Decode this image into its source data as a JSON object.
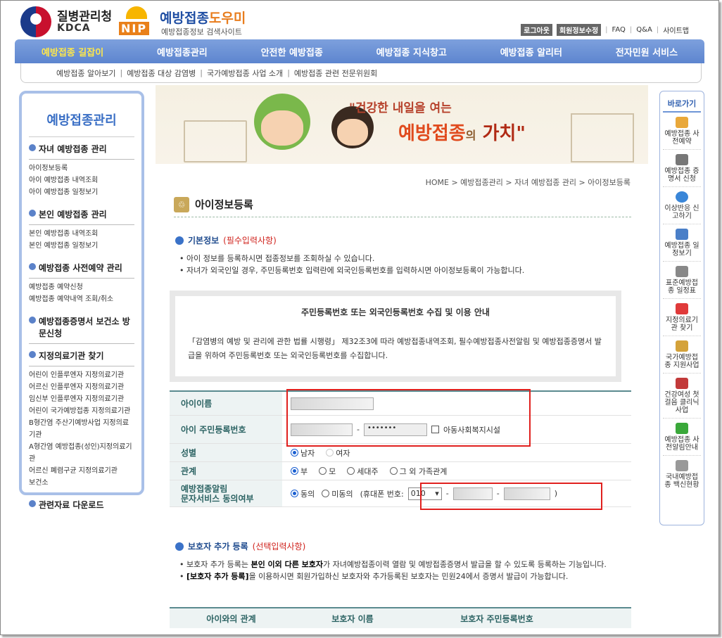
{
  "header": {
    "org_name": "질병관리청",
    "org_en": "KDCA",
    "nip_text": "NIP",
    "site_title_main": "예방접종",
    "site_title_accent": "도우미",
    "site_subtitle": "예방접종정보 검색사이트",
    "util": {
      "logout": "로그아웃",
      "member_edit": "회원정보수정",
      "faq": "FAQ",
      "qna": "Q&A",
      "sitemap": "사이트맵",
      "sep": "|"
    }
  },
  "topnav": [
    "예방접종 길잡이",
    "예방접종관리",
    "안전한 예방접종",
    "예방접종 지식창고",
    "예방접종 알리터",
    "전자민원 서비스"
  ],
  "subnav": [
    "예방접종 알아보기",
    "예방접종 대상 감염병",
    "국가예방접종 사업 소개",
    "예방접종 관련 전문위원회"
  ],
  "sidebar": {
    "title": "예방접종관리",
    "sections": [
      {
        "title": "자녀 예방접종 관리",
        "items": [
          "아이정보등록",
          "아이 예방접종 내역조회",
          "아이 예방접종 일정보기"
        ]
      },
      {
        "title": "본인 예방접종 관리",
        "items": [
          "본인 예방접종 내역조회",
          "본인 예방접종 일정보기"
        ]
      },
      {
        "title": "예방접종 사전예약 관리",
        "items": [
          "예방접종 예약신청",
          "예방접종 예약내역 조회/취소"
        ]
      },
      {
        "title": "예방접종증명서 보건소 방문신청",
        "items": []
      },
      {
        "title": "지정의료기관 찾기",
        "items": [
          "어린이 인플루엔자 지정의료기관",
          "어르신 인플루엔자 지정의료기관",
          "임신부 인플루엔자 지정의료기관",
          "어린이 국가예방접종 지정의료기관",
          "B형간염 주산기예방사업 지정의료기관",
          "A형간염 예방접종(성인)지정의료기관",
          "어르신 폐렴구균 지정의료기관",
          "보건소"
        ]
      },
      {
        "title": "관련자료 다운로드",
        "items": []
      }
    ]
  },
  "quick": {
    "title": "바로가기",
    "items": [
      {
        "label": "예방접종 사전예약",
        "icon": "calendar-icon",
        "color": "#e9a83a"
      },
      {
        "label": "예방접종 증명서 신청",
        "icon": "printer-icon",
        "color": "#777777"
      },
      {
        "label": "이상반응 신고하기",
        "icon": "check-circle-icon",
        "color": "#3a86d8"
      },
      {
        "label": "예방접종 일정보기",
        "icon": "schedule-icon",
        "color": "#4a7fc8"
      },
      {
        "label": "표준예방접종 일정표",
        "icon": "syringe-icon",
        "color": "#888888"
      },
      {
        "label": "지정의료기관 찾기",
        "icon": "hospital-icon",
        "color": "#e03a3a"
      },
      {
        "label": "국가예방접종 지원사업",
        "icon": "document-icon",
        "color": "#d4a23a"
      },
      {
        "label": "건강여성 첫걸음 클리닉사업",
        "icon": "box-icon",
        "color": "#c23a3a"
      },
      {
        "label": "예방접종 사전알림안내",
        "icon": "speaker-icon",
        "color": "#3aa83a"
      },
      {
        "label": "국내예방접종 백신현황",
        "icon": "vial-icon",
        "color": "#999999"
      }
    ]
  },
  "banner": {
    "slogan_line1": "\"건강한 내일을 여는",
    "slogan_main1": "예방접종",
    "slogan_small": "의",
    "slogan_main2": "가치\""
  },
  "content": {
    "breadcrumb": "HOME > 예방접종관리 > 자녀 예방접종 관리 > 아이정보등록",
    "page_title": "아이정보등록",
    "basic_title": "기본정보",
    "basic_req": "(필수입력사항)",
    "basic_bullets": [
      "아이 정보를 등록하시면 접종정보를 조회하실 수 있습니다.",
      "자녀가 외국인일 경우, 주민등록번호 입력란에 외국인등록번호를 입력하시면 아이정보등록이 가능합니다."
    ],
    "notice_title": "주민등록번호 또는 외국인등록번호 수집 및 이용 안내",
    "notice_body": "「감염병의 예방 및 관리에 관한 법률 시행령」 제32조3에 따라 예방접종내역조회, 필수예방접종사전알림 및 예방접종증명서 발급을 위하여 주민등록번호 또는 외국인등록번호를 수집합니다.",
    "form": {
      "name_label": "아이이름",
      "rrn_label": "아이 주민등록번호",
      "rrn_second": "•••••••",
      "rrn_dash": "-",
      "welfare_label": "아동사회복지시설",
      "gender_label": "성별",
      "gender_male": "남자",
      "gender_female": "여자",
      "relation_label": "관계",
      "relation_options": [
        "부",
        "모",
        "세대주",
        "그 외 가족관계"
      ],
      "sms_label_1": "예방접종알림",
      "sms_label_2": "문자서비스 동의여부",
      "sms_agree": "동의",
      "sms_disagree": "미동의",
      "phone_prefix": "(휴대폰 번호:",
      "phone_select": "010",
      "phone_suffix": ")"
    },
    "guardian_title": "보호자 추가 등록",
    "guardian_opt": "(선택입력사항)",
    "guardian_b1_pre": "보호자 추가 등록는 ",
    "guardian_b1_bold": "본인 이외 다른 보호자",
    "guardian_b1_post": "가 자녀예방접종이력 열람 및 예방접종증명서 발급을 할 수 있도록 등록하는 기능입니다.",
    "guardian_b2_bold": "[보호자 추가 등록]",
    "guardian_b2_post": "을 이용하시면 회원가입하신 보호자와 추가등록된 보호자는 민원24에서 증명서 발급이 가능합니다.",
    "guardian_cols": [
      "아이와의 관계",
      "보호자 이름",
      "보호자 주민등록번호"
    ]
  }
}
